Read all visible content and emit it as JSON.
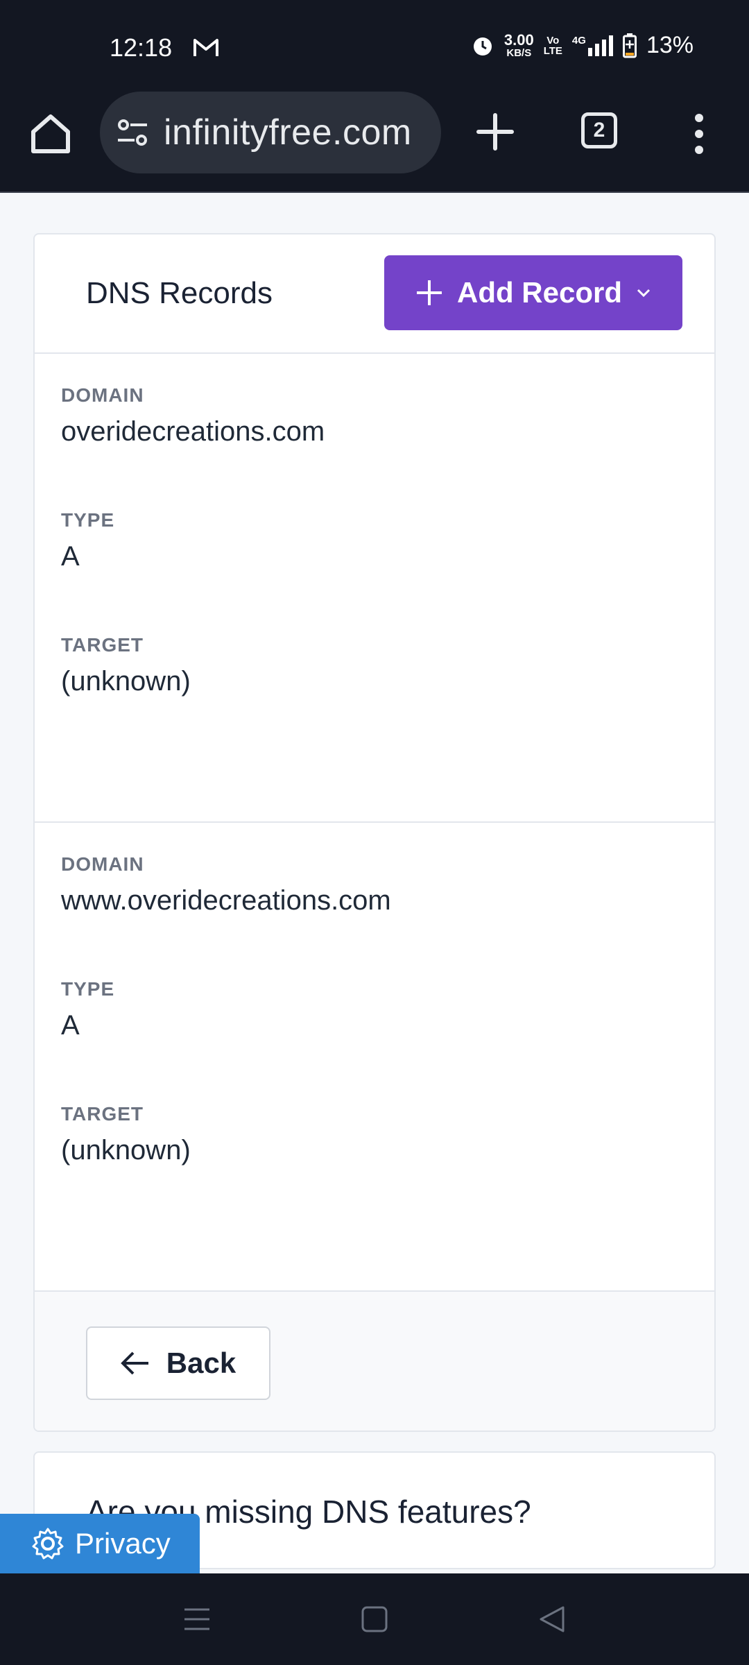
{
  "status_bar": {
    "time": "12:18",
    "net_speed_value": "3.00",
    "net_speed_unit": "KB/S",
    "volte_top": "Vo",
    "volte_bottom": "LTE",
    "network": "4G",
    "battery": "13%"
  },
  "browser": {
    "url": "infinityfree.com",
    "tab_count": "2"
  },
  "card": {
    "title": "DNS Records",
    "add_button_label": "Add Record",
    "records": [
      {
        "domain_label": "DOMAIN",
        "domain": "overidecreations.com",
        "type_label": "TYPE",
        "type": "A",
        "target_label": "TARGET",
        "target": "(unknown)"
      },
      {
        "domain_label": "DOMAIN",
        "domain": "www.overidecreations.com",
        "type_label": "TYPE",
        "type": "A",
        "target_label": "TARGET",
        "target": "(unknown)"
      }
    ],
    "back_label": "Back"
  },
  "card2": {
    "title": "Are you missing DNS features?"
  },
  "privacy": {
    "label": "Privacy"
  },
  "colors": {
    "accent": "#7443c9",
    "privacy": "#2f86d6",
    "dark_bar": "#131722"
  }
}
